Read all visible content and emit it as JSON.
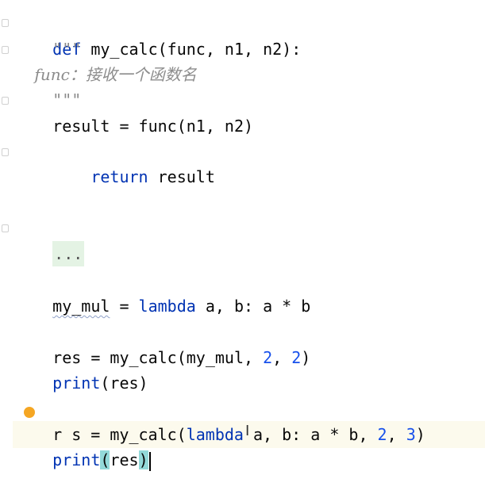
{
  "editor": {
    "lines": {
      "l1_def": "def",
      "l1_rest": " my_calc(func, n1, n2):",
      "l2": "    \"\"\"",
      "l3": "    func：接收一个函数名",
      "l4": "    \"\"\"",
      "l5": "    result = func(n1, n2)",
      "l6_kw": "return",
      "l6_rest": " result",
      "l7": "...",
      "l8_name": "my_mul",
      "l8_eq": " = ",
      "l8_kw": "lambda",
      "l8_rest": " a, b: a * b",
      "l9_a": "res = my_calc(my_mul, ",
      "l9_n1": "2",
      "l9_b": ", ",
      "l9_n2": "2",
      "l9_c": ")",
      "l10_kw": "print",
      "l10_rest": "(res)",
      "l11_a": "r",
      "l11_b": "s = my_calc(",
      "l11_kw": "lambda",
      "l11_c": " a, b: a * b, ",
      "l11_n1": "2",
      "l11_d": ", ",
      "l11_n2": "3",
      "l11_e": ")",
      "l12_kw": "print",
      "l12_open": "(",
      "l12_mid": "res",
      "l12_close": ")"
    },
    "cursor_glyph": "I"
  },
  "colors": {
    "keyword": "#0033b3",
    "number": "#1750eb",
    "docstring": "#8c8c8c",
    "text": "#080808",
    "current_line_bg": "#fcfaed",
    "brace_highlight": "#93d9d9",
    "intention_bulb": "#f5a623"
  },
  "icons": [
    "fold-marker-icon",
    "intention-bulb-icon",
    "text-cursor-icon"
  ]
}
